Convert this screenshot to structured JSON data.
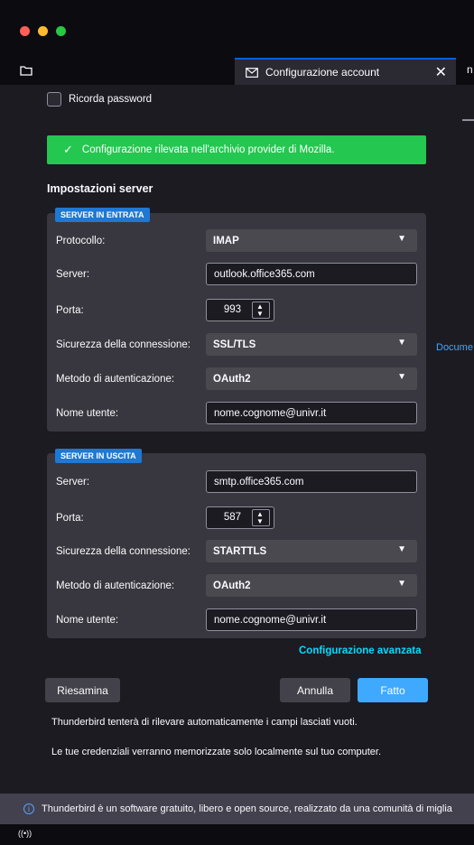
{
  "tab": {
    "title": "Configurazione account",
    "close": "✕"
  },
  "remember_password": "Ricorda password",
  "banner": "Configurazione rilevata nell'archivio provider di Mozilla.",
  "server_settings_title": "Impostazioni server",
  "incoming": {
    "badge": "SERVER IN ENTRATA",
    "protocol_label": "Protocollo:",
    "protocol_value": "IMAP",
    "server_label": "Server:",
    "server_value": "outlook.office365.com",
    "port_label": "Porta:",
    "port_value": "993",
    "security_label": "Sicurezza della connessione:",
    "security_value": "SSL/TLS",
    "auth_label": "Metodo di autenticazione:",
    "auth_value": "OAuth2",
    "username_label": "Nome utente:",
    "username_value": "nome.cognome@univr.it"
  },
  "outgoing": {
    "badge": "SERVER IN USCITA",
    "server_label": "Server:",
    "server_value": "smtp.office365.com",
    "port_label": "Porta:",
    "port_value": "587",
    "security_label": "Sicurezza della connessione:",
    "security_value": "STARTTLS",
    "auth_label": "Metodo di autenticazione:",
    "auth_value": "OAuth2",
    "username_label": "Nome utente:",
    "username_value": "nome.cognome@univr.it"
  },
  "side_link": "Docume",
  "advanced_link": "Configurazione avanzata",
  "buttons": {
    "review": "Riesamina",
    "cancel": "Annulla",
    "done": "Fatto"
  },
  "info1": "Thunderbird tenterà di rilevare automaticamente i campi lasciati vuoti.",
  "info2": "Le tue credenziali verranno memorizzate solo localmente sul tuo computer.",
  "notice": "Thunderbird è un software gratuito, libero e open source, realizzato da una comunità di miglia",
  "icons": {
    "folder": "folder-icon",
    "mail": "mail-icon",
    "info": "info-icon",
    "wifi": "activity-icon"
  },
  "colors": {
    "accent": "#3fa9ff",
    "banner": "#24c74f",
    "link": "#00ddff",
    "badge": "#1f78d1"
  }
}
